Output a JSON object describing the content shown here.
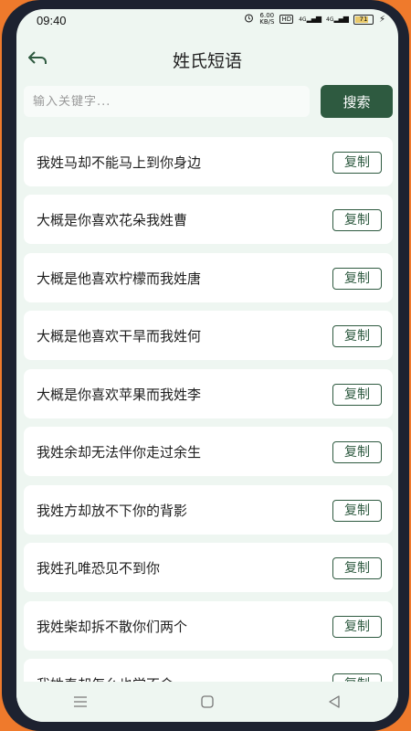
{
  "status": {
    "time": "09:40",
    "speed": "6.00",
    "speed_unit": "KB/S",
    "hd": "HD",
    "net1": "4G",
    "net2": "4G",
    "battery": "71"
  },
  "header": {
    "title": "姓氏短语"
  },
  "search": {
    "placeholder": "输入关键字...",
    "button": "搜索"
  },
  "copy_label": "复制",
  "items": [
    "我姓马却不能马上到你身边",
    "大概是你喜欢花朵我姓曹",
    "大概是他喜欢柠檬而我姓唐",
    "大概是他喜欢干旱而我姓何",
    "大概是你喜欢苹果而我姓李",
    "我姓余却无法伴你走过余生",
    "我姓方却放不下你的背影",
    "我姓孔唯恐见不到你",
    "我姓柴却拆不散你们两个",
    "我姓秦却怎么也学不会"
  ]
}
